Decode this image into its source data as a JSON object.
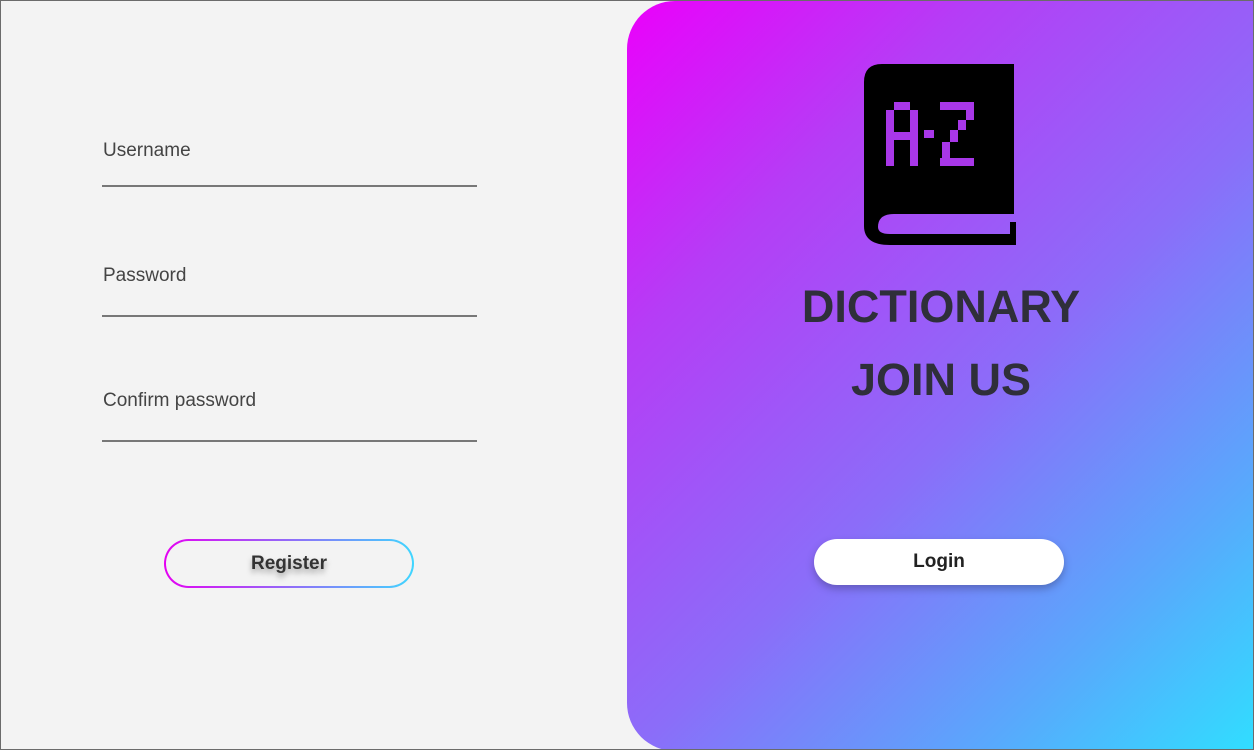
{
  "register_form": {
    "username_label": "Username",
    "password_label": "Password",
    "confirm_password_label": "Confirm password",
    "register_label": "Register"
  },
  "side_panel": {
    "logo_icon": "a-z-dictionary-book-icon",
    "logo_text": "A-Z",
    "title": "DICTIONARY",
    "subtitle": "JOIN US",
    "login_label": "Login"
  },
  "colors": {
    "gradient_start": "#eb00fb",
    "gradient_end": "#30deff",
    "form_background": "#f3f3f3",
    "letter_color": "#a837e8"
  }
}
